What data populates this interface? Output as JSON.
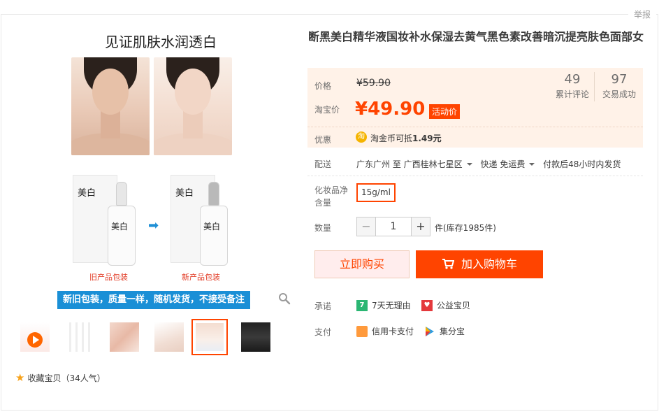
{
  "report_label": "举报",
  "gallery": {
    "hero_title": "见证肌肤水润透白",
    "old_box_brand": "美白",
    "new_box_brand": "美白",
    "bottle_label": "美白",
    "old_pack_label": "旧产品包装",
    "new_pack_label": "新产品包装",
    "banner": "新旧包装，质量一样，随机发货，不接受备注",
    "active_thumb_index": 4
  },
  "favorite": {
    "label": "收藏宝贝（34人气）"
  },
  "product": {
    "title": "断黑美白精华液国妆补水保湿去黄气黑色素改善暗沉提亮肤色面部女",
    "price_label": "价格",
    "original_price": "¥59.90",
    "promo_price_label": "淘宝价",
    "promo_price": "¥49.90",
    "promo_tag": "活动价",
    "reviews_count": "49",
    "reviews_label": "累计评论",
    "sales_count": "97",
    "sales_label": "交易成功",
    "discount_label": "优惠",
    "coin_glyph": "淘",
    "discount_text_prefix": "淘金币可抵",
    "discount_amount": "1.49元"
  },
  "shipping": {
    "label": "配送",
    "from": "广东广州 至",
    "to": "广西桂林七星区",
    "method": "快递 免运费",
    "note": "付款后48小时内发货"
  },
  "spec": {
    "label": "化妆品净含量",
    "option": "15g/ml"
  },
  "quantity": {
    "label": "数量",
    "value": "1",
    "minus": "−",
    "plus": "+",
    "stock": "件(库存1985件)"
  },
  "actions": {
    "buy_now": "立即购买",
    "add_to_cart": "加入购物车"
  },
  "promise": {
    "label": "承诺",
    "items": [
      {
        "icon": "seven-day-return-icon",
        "glyph": "7",
        "color": "#2bb673",
        "text": "7天无理由"
      },
      {
        "icon": "charity-icon",
        "glyph": "♥",
        "color": "#e4393c",
        "text": "公益宝贝"
      }
    ]
  },
  "payment": {
    "label": "支付",
    "items": [
      {
        "icon": "credit-card-icon",
        "color": "#ff9a3c",
        "text": "信用卡支付"
      },
      {
        "icon": "jifenbao-icon",
        "color": "#2f9de0",
        "text": "集分宝"
      }
    ]
  }
}
